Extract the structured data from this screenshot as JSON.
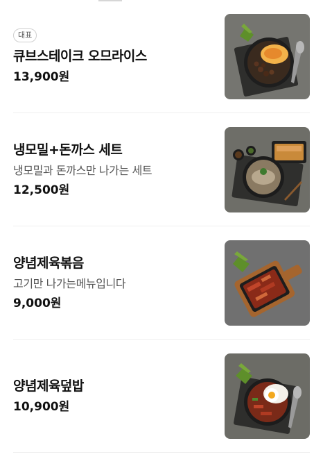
{
  "menu": {
    "items": [
      {
        "badge": "대표",
        "name": "큐브스테이크 오므라이스",
        "description": "",
        "price": "13,900원",
        "image": "cube-steak-omurice-photo"
      },
      {
        "badge": "",
        "name": "냉모밀+돈까스 세트",
        "description": "냉모밀과 돈까스만 나가는 세트",
        "price": "12,500원",
        "image": "cold-soba-pork-cutlet-set-photo"
      },
      {
        "badge": "",
        "name": "양념제육볶음",
        "description": "고기만 나가는메뉴입니다",
        "price": "9,000원",
        "image": "spicy-stir-fried-pork-photo"
      },
      {
        "badge": "",
        "name": "양념제육덮밥",
        "description": "",
        "price": "10,900원",
        "image": "spicy-pork-rice-bowl-photo"
      }
    ]
  },
  "colors": {
    "background": "#ffffff",
    "divider": "#efefef",
    "text_primary": "#111111",
    "text_secondary": "#555555"
  }
}
